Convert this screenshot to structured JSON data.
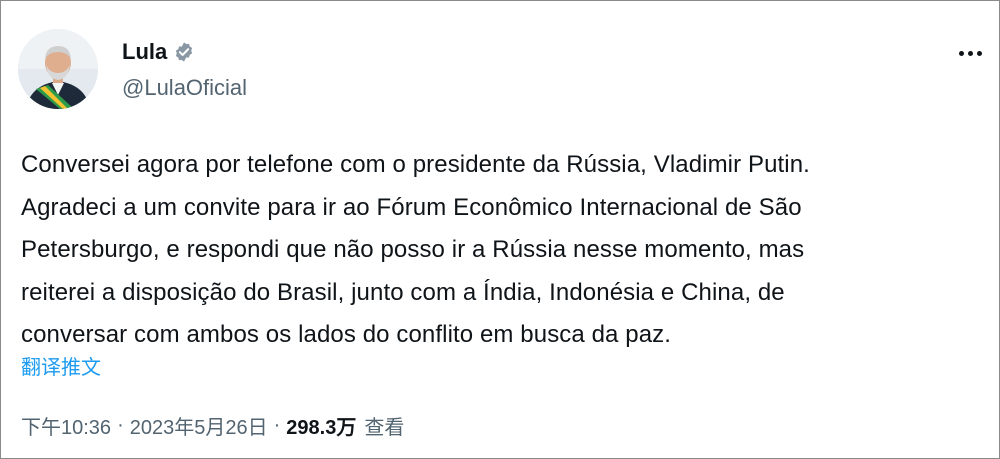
{
  "author": {
    "name": "Lula",
    "handle": "@LulaOficial",
    "verified": true
  },
  "tweet": {
    "text": "Conversei agora por telefone com o presidente da Rússia, Vladimir Putin.\nAgradeci a um convite para ir ao Fórum Econômico Internacional de São\nPetersburgo, e respondi que não posso ir a Rússia nesse momento, mas\nreiterei a disposição do Brasil, junto com a Índia, Indonésia e China, de\nconversar com ambos os lados do conflito em busca da paz.",
    "translate_label": "翻译推文",
    "time": "下午10:36",
    "separator": "·",
    "date": "2023年5月26日",
    "views_count": "298.3万",
    "views_label": "查看"
  },
  "icons": {
    "more": "more-horizontal-icon",
    "verified": "verified-badge-icon"
  },
  "colors": {
    "accent": "#1d9bf0",
    "text": "#0f1419",
    "secondary": "#536471"
  }
}
